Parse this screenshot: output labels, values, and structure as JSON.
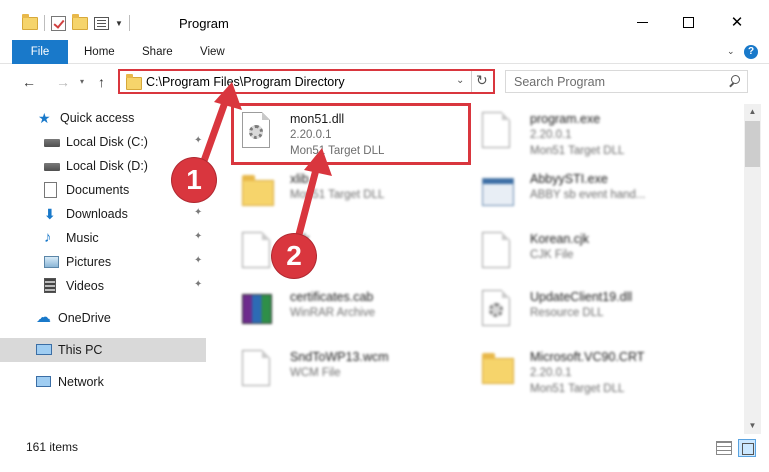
{
  "window": {
    "title": "Program",
    "minimize_glyph": "–",
    "close_glyph": "✕"
  },
  "ribbon": {
    "tabs": [
      {
        "label": "File"
      },
      {
        "label": "Home"
      },
      {
        "label": "Share"
      },
      {
        "label": "View"
      }
    ],
    "help_glyph": "?"
  },
  "nav": {
    "back_glyph": "←",
    "forward_glyph": "→",
    "up_glyph": "↑",
    "address": "C:\\Program Files\\Program Directory",
    "search_placeholder": "Search Program"
  },
  "sidebar": {
    "items": [
      {
        "label": "Quick access",
        "icon": "star-icon"
      },
      {
        "label": "Local Disk (C:)",
        "icon": "disk-icon",
        "pinned": true
      },
      {
        "label": "Local Disk (D:)",
        "icon": "disk-icon"
      },
      {
        "label": "Documents",
        "icon": "documents-icon",
        "pinned": true
      },
      {
        "label": "Downloads",
        "icon": "download-icon",
        "pinned": true
      },
      {
        "label": "Music",
        "icon": "music-icon",
        "pinned": true
      },
      {
        "label": "Pictures",
        "icon": "pictures-icon",
        "pinned": true
      },
      {
        "label": "Videos",
        "icon": "videos-icon",
        "pinned": true
      },
      {
        "label": "OneDrive",
        "icon": "cloud-icon"
      },
      {
        "label": "This PC",
        "icon": "computer-icon",
        "selected": true
      },
      {
        "label": "Network",
        "icon": "network-icon"
      }
    ]
  },
  "files": {
    "highlighted": {
      "name": "mon51.dll",
      "version": "2.20.0.1",
      "description": "Mon51 Target DLL"
    },
    "others": [
      {
        "name": "program.exe",
        "line2": "2.20.0.1",
        "line3": "Mon51 Target DLL"
      },
      {
        "name": "xlib",
        "line2": "Mon51 Target DLL",
        "line3": ""
      },
      {
        "name": "AbbyySTI.exe",
        "line2": "ABBY sb event hand...",
        "line3": ""
      },
      {
        "name": "...jk",
        "line2": "",
        "line3": ""
      },
      {
        "name": "Korean.cjk",
        "line2": "CJK File",
        "line3": ""
      },
      {
        "name": "certificates.cab",
        "line2": "WinRAR Archive",
        "line3": ""
      },
      {
        "name": "UpdateClient19.dll",
        "line2": "Resource DLL",
        "line3": ""
      },
      {
        "name": "SndToWP13.wcm",
        "line2": "WCM File",
        "line3": ""
      },
      {
        "name": "Microsoft.VC90.CRT",
        "line2": "2.20.0.1",
        "line3": "Mon51 Target DLL"
      }
    ]
  },
  "status": {
    "item_count": "161 items"
  },
  "annotations": {
    "badge1": "1",
    "badge2": "2"
  },
  "colors": {
    "accent": "#1979ca",
    "highlight_red": "#d9363e",
    "selection": "#cce8ff"
  }
}
